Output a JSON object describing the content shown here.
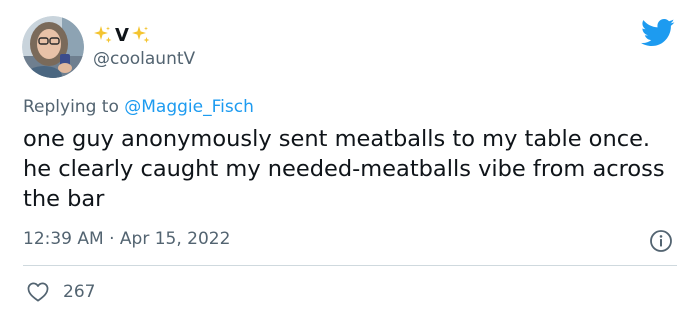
{
  "tweet": {
    "author": {
      "display_name_text": "V",
      "display_name_emoji": "sparkles",
      "handle": "@coolauntV",
      "avatar": "profile-photo"
    },
    "reply_context": {
      "prefix": "Replying to",
      "mention": "@Maggie_Fisch"
    },
    "text": "one guy anonymously sent meatballs to my table once. he clearly caught my needed-meatballs vibe from across the bar",
    "timestamp": "12:39 AM · Apr 15, 2022",
    "likes": "267",
    "icons": {
      "platform": "twitter-bird-icon",
      "info": "info-icon",
      "like": "heart-outline-icon"
    }
  },
  "colors": {
    "brand_blue": "#1d9bf0",
    "secondary_text": "#536471",
    "primary_text": "#0f1419",
    "divider": "#cfd9de",
    "sparkle_gold": "#f4c430"
  }
}
